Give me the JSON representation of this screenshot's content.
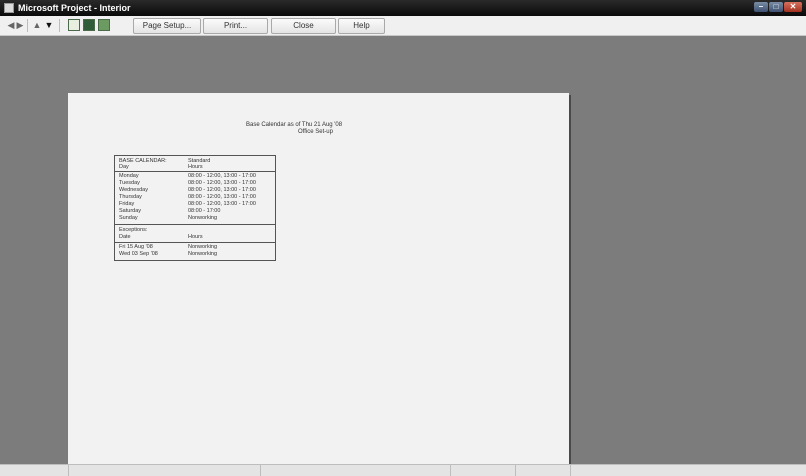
{
  "window": {
    "title": "Microsoft Project - Interior",
    "minimize": "–",
    "maximize": "□",
    "close": "✕"
  },
  "toolbar": {
    "icons": [
      "prev-page-icon",
      "next-page-icon",
      "up-icon",
      "down-icon",
      "zoom-icon",
      "one-page-icon",
      "multi-page-icon"
    ],
    "page_setup_label": "Page Setup...",
    "print_label": "Print...",
    "close_label": "Close",
    "help_label": "Help"
  },
  "report": {
    "title": "Base Calendar as of Thu 21 Aug '08",
    "subtitle": "Office Set-up",
    "calendar": {
      "header": [
        "BASE CALENDAR:",
        "Standard"
      ],
      "subheader": [
        "Day",
        "Hours"
      ],
      "days": [
        {
          "day": "Monday",
          "hours": "08:00 - 12:00, 13:00 - 17:00"
        },
        {
          "day": "Tuesday",
          "hours": "08:00 - 12:00, 13:00 - 17:00"
        },
        {
          "day": "Wednesday",
          "hours": "08:00 - 12:00, 13:00 - 17:00"
        },
        {
          "day": "Thursday",
          "hours": "08:00 - 12:00, 13:00 - 17:00"
        },
        {
          "day": "Friday",
          "hours": "08:00 - 12:00, 13:00 - 17:00"
        },
        {
          "day": "Saturday",
          "hours": "08:00 - 17:00"
        },
        {
          "day": "Sunday",
          "hours": "Nonworking"
        }
      ],
      "exceptions_label": "Exceptions:",
      "exceptions_header": [
        "Date",
        "Hours"
      ],
      "exceptions": [
        {
          "date": "Fri 15 Aug '08",
          "hours": "Nonworking"
        },
        {
          "date": "Wed 03 Sep '08",
          "hours": "Nonworking"
        }
      ]
    }
  }
}
